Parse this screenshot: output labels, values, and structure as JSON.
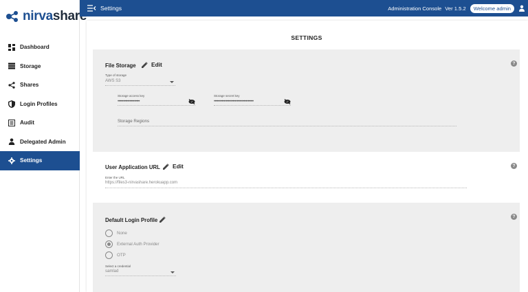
{
  "app": {
    "logo_nirva": "nirva",
    "logo_share": "share"
  },
  "sidebar": {
    "items": [
      {
        "label": "Dashboard",
        "icon": "dashboard-icon",
        "active": false
      },
      {
        "label": "Storage",
        "icon": "storage-icon",
        "active": false
      },
      {
        "label": "Shares",
        "icon": "share-icon",
        "active": false
      },
      {
        "label": "Login Profiles",
        "icon": "shield-icon",
        "active": false
      },
      {
        "label": "Audit",
        "icon": "list-icon",
        "active": false
      },
      {
        "label": "Delegated Admin",
        "icon": "person-icon",
        "active": false
      },
      {
        "label": "Settings",
        "icon": "gear-icon",
        "active": true
      }
    ]
  },
  "topbar": {
    "title": "Settings",
    "admin_console": "Administration Console",
    "version": "Ver 1.5.2",
    "welcome": "Welcome admin"
  },
  "page": {
    "title": "SETTINGS"
  },
  "file_storage": {
    "title": "File Storage",
    "edit_label": "Edit",
    "help": "?",
    "type_label": "Type of storage",
    "type_value": "AWS S3",
    "access_key_label": "Storage access key",
    "access_key_value": "••••••••••••••••••••",
    "secret_key_label": "Storage secret key",
    "secret_key_value": "••••••••••••••••••••••••••••••••••••",
    "regions_placeholder": "Storage Regions"
  },
  "user_app_url": {
    "title": "User Application URL",
    "edit_label": "Edit",
    "help": "?",
    "url_label": "Enter the URL",
    "url_value": "https://files3-nirvashare.herokuapp.com"
  },
  "default_login": {
    "title": "Default Login Profile",
    "help": "?",
    "options": [
      {
        "label": "None",
        "selected": false
      },
      {
        "label": "External Auth Provider",
        "selected": true
      },
      {
        "label": "OTP",
        "selected": false
      }
    ],
    "credential_label": "Select a credential",
    "credential_value": "samlad"
  },
  "colors": {
    "primary": "#1d4f91",
    "card_grey": "#eeeeee"
  }
}
